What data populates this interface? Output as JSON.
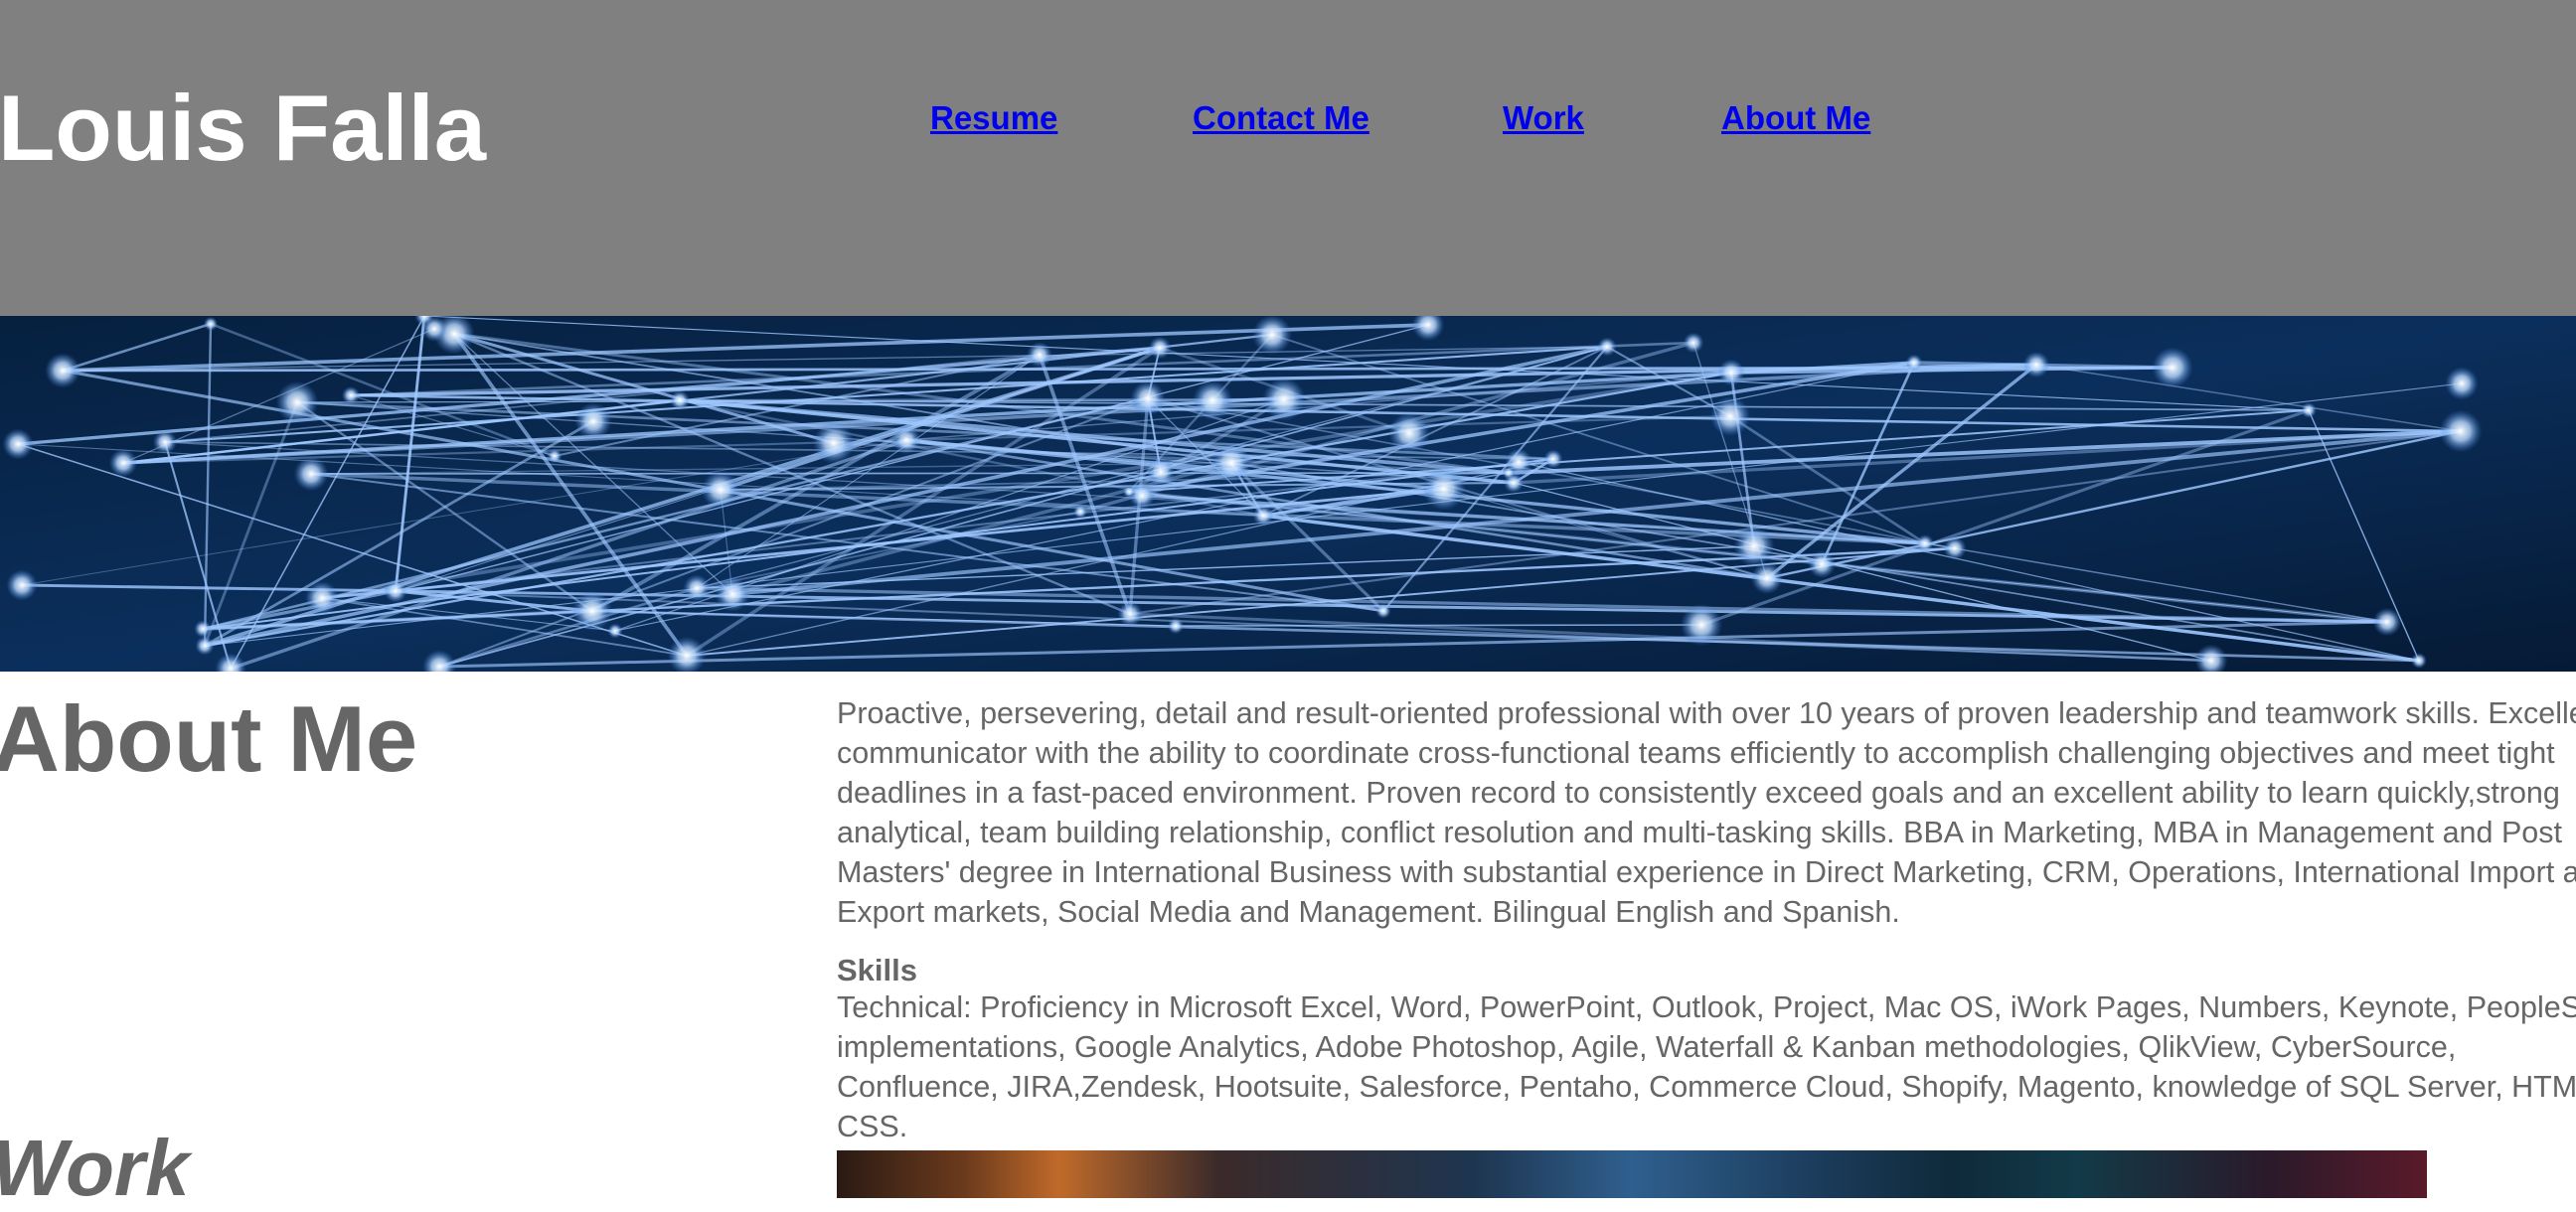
{
  "header": {
    "site_title": "Louis Falla",
    "nav": [
      {
        "label": "Resume"
      },
      {
        "label": "Contact Me"
      },
      {
        "label": "Work"
      },
      {
        "label": "About Me"
      }
    ]
  },
  "colors": {
    "header_bg": "#808080",
    "link": "#0000ee",
    "text_gray": "#666666",
    "banner_dark": "#04142e",
    "banner_line": "#9fc8ff"
  },
  "about": {
    "heading": "About Me",
    "paragraph": "Proactive, persevering, detail and result-oriented professional with over 10 years of proven leadership and teamwork skills. Excellent communicator with the ability to coordinate cross-functional teams efficiently to accomplish challenging objectives and meet tight deadlines in a fast-paced environment. Proven record to consistently exceed goals and an excellent ability to learn quickly,strong analytical, team building relationship, conflict resolution and multi-tasking skills. BBA in Marketing, MBA in Management and Post Masters' degree in International Business with substantial experience in Direct Marketing, CRM, Operations, International Import and Export markets, Social Media and Management. Bilingual English and Spanish.",
    "skills_title": "Skills",
    "skills_text": "Technical: Proficiency in Microsoft Excel, Word, PowerPoint, Outlook, Project, Mac OS, iWork Pages, Numbers, Keynote, PeopleSoft implementations, Google Analytics, Adobe Photoshop, Agile, Waterfall & Kanban methodologies, QlikView, CyberSource, Confluence, JIRA,Zendesk, Hootsuite, Salesforce, Pentaho, Commerce Cloud, Shopify, Magento, knowledge of SQL Server, HTML, CSS."
  },
  "work": {
    "heading": "Work"
  },
  "images": {
    "banner": "network-lines-image",
    "work": "city-lights-image"
  }
}
